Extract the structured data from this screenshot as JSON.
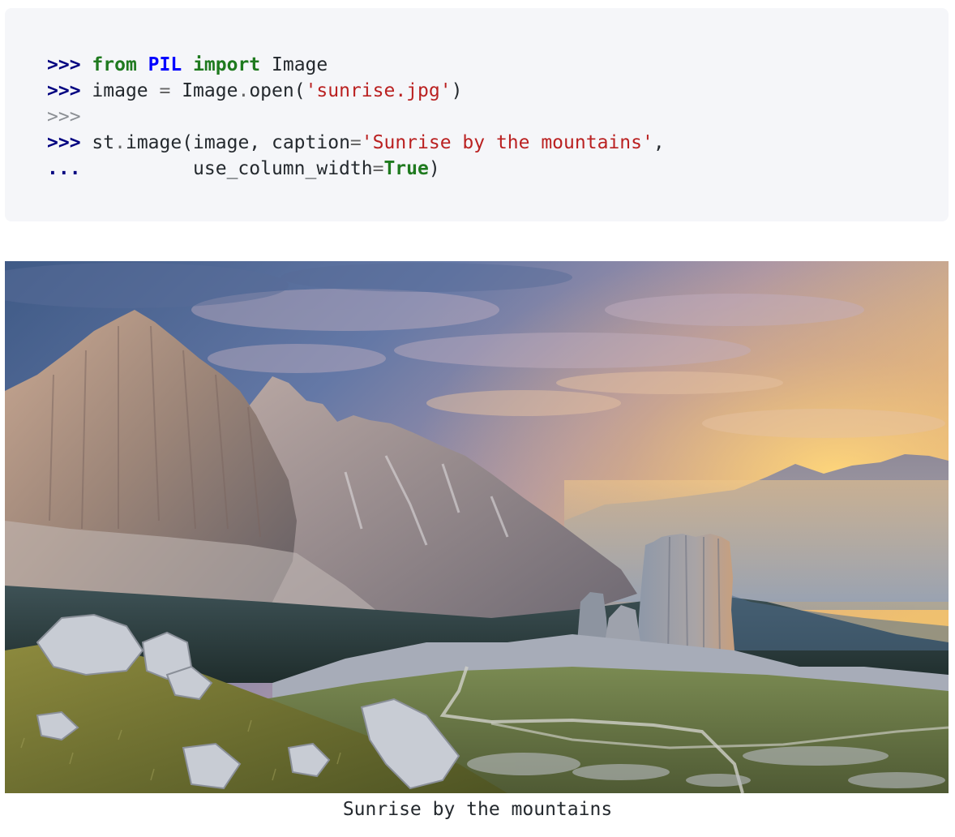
{
  "code": {
    "lines": [
      {
        "prompt": ">>>",
        "tokens": [
          {
            "text": "from",
            "kind": "kw"
          },
          {
            "text": " ",
            "kind": "name"
          },
          {
            "text": "PIL",
            "kind": "mod"
          },
          {
            "text": " ",
            "kind": "name"
          },
          {
            "text": "import",
            "kind": "kw"
          },
          {
            "text": " Image",
            "kind": "name"
          }
        ]
      },
      {
        "prompt": ">>>",
        "tokens": [
          {
            "text": "image ",
            "kind": "name"
          },
          {
            "text": "=",
            "kind": "op"
          },
          {
            "text": " Image",
            "kind": "name"
          },
          {
            "text": ".",
            "kind": "op"
          },
          {
            "text": "open(",
            "kind": "name"
          },
          {
            "text": "'sunrise.jpg'",
            "kind": "str"
          },
          {
            "text": ")",
            "kind": "name"
          }
        ]
      },
      {
        "prompt": ">>>",
        "prompt_dim": true,
        "tokens": []
      },
      {
        "prompt": ">>>",
        "tokens": [
          {
            "text": "st",
            "kind": "name"
          },
          {
            "text": ".",
            "kind": "op"
          },
          {
            "text": "image(image, caption",
            "kind": "name"
          },
          {
            "text": "=",
            "kind": "op"
          },
          {
            "text": "'Sunrise by the mountains'",
            "kind": "str"
          },
          {
            "text": ",",
            "kind": "name"
          }
        ]
      },
      {
        "prompt": "...",
        "tokens": [
          {
            "text": "         use_column_width",
            "kind": "name"
          },
          {
            "text": "=",
            "kind": "op"
          },
          {
            "text": "True",
            "kind": "builtin"
          },
          {
            "text": ")",
            "kind": "name"
          }
        ]
      }
    ]
  },
  "figure": {
    "caption": "Sunrise by the mountains"
  },
  "colors": {
    "code_background": "#f5f6f9",
    "prompt": "#000080",
    "keyword": "#1f7a1f",
    "module": "#0000ff",
    "string": "#ba2121"
  }
}
